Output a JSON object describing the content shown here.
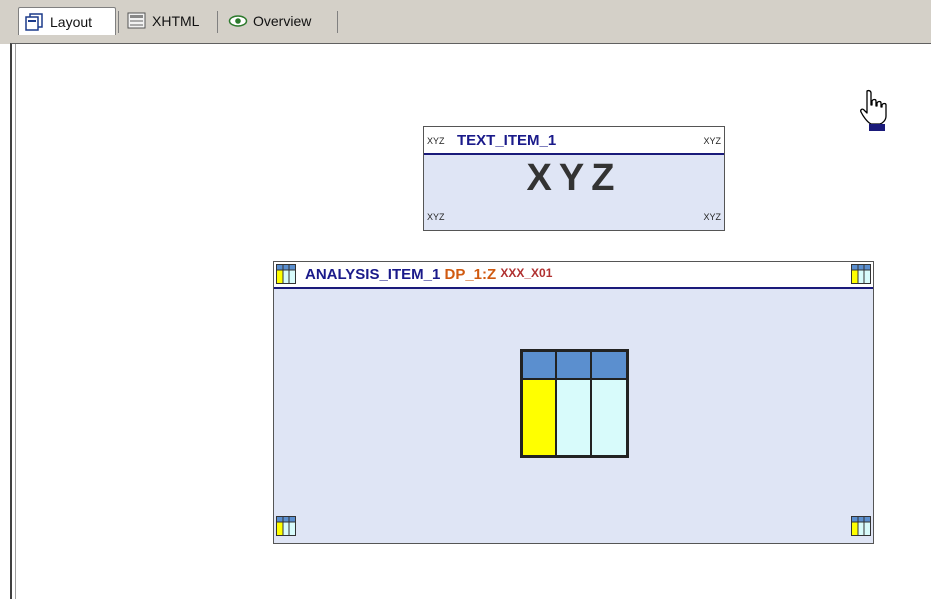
{
  "tabs": [
    {
      "label": "Layout",
      "icon": "layout-icon",
      "active": true
    },
    {
      "label": "XHTML",
      "icon": "xhtml-icon",
      "active": false
    },
    {
      "label": "Overview",
      "icon": "eye-icon",
      "active": false
    }
  ],
  "text_item": {
    "name": "TEXT_ITEM_1",
    "corner_label": "XYZ",
    "content": "XYZ"
  },
  "analysis_item": {
    "name": "ANALYSIS_ITEM_1",
    "dataprovider": "DP_1:Z",
    "query": "XXX_X01",
    "icon": "table-grid-icon"
  },
  "colors": {
    "item_background": "#dfe5f5",
    "header_rule": "#1a1a7a",
    "title_navy": "#1a1a8a",
    "dataprovider_orange": "#d05a10",
    "query_red": "#b03030",
    "table_header_blue": "#5b8fcf",
    "table_yellow": "#ffff00",
    "table_cyan": "#d8fbfb"
  },
  "cursor": {
    "icon": "hand-pointer-icon"
  }
}
